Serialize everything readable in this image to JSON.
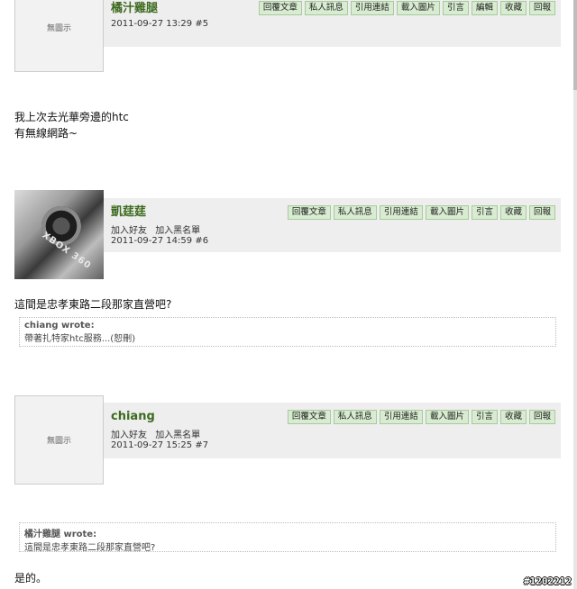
{
  "posts": [
    {
      "author": "橘汁雞腿",
      "avatar_text": "無圖示",
      "has_links": false,
      "links": [],
      "date": "2011-09-27 13:29",
      "num": "#5",
      "buttons": [
        "回覆文章",
        "私人訊息",
        "引用連結",
        "載入圖片",
        "引言",
        "編輯",
        "收藏",
        "回報"
      ],
      "body_lines": [
        "我上次去光華旁邊的htc",
        "有無線網路~"
      ],
      "quote": null
    },
    {
      "author": "凱莛莛",
      "avatar_text": "XBOX 360",
      "has_links": true,
      "links": [
        "加入好友",
        "加入黑名單"
      ],
      "date": "2011-09-27 14:59",
      "num": "#6",
      "buttons": [
        "回覆文章",
        "私人訊息",
        "引用連結",
        "載入圖片",
        "引言",
        "收藏",
        "回報"
      ],
      "body_lines": [
        "這間是忠孝東路二段那家直營吧?"
      ],
      "quote": {
        "head": "chiang wrote:",
        "text": "帶著扎特家htc服務...(恕刪)"
      }
    },
    {
      "author": "chiang",
      "avatar_text": "無圖示",
      "has_links": true,
      "links": [
        "加入好友",
        "加入黑名單"
      ],
      "date": "2011-09-27 15:25",
      "num": "#7",
      "buttons": [
        "回覆文章",
        "私人訊息",
        "引用連結",
        "載入圖片",
        "引言",
        "收藏",
        "回報"
      ],
      "body_lines": [
        "是的。"
      ],
      "quote": {
        "head": "橘汁雞腿 wrote:",
        "text": "這間是忠孝東路二段那家直營吧?"
      }
    }
  ],
  "watermark": "#1202212"
}
